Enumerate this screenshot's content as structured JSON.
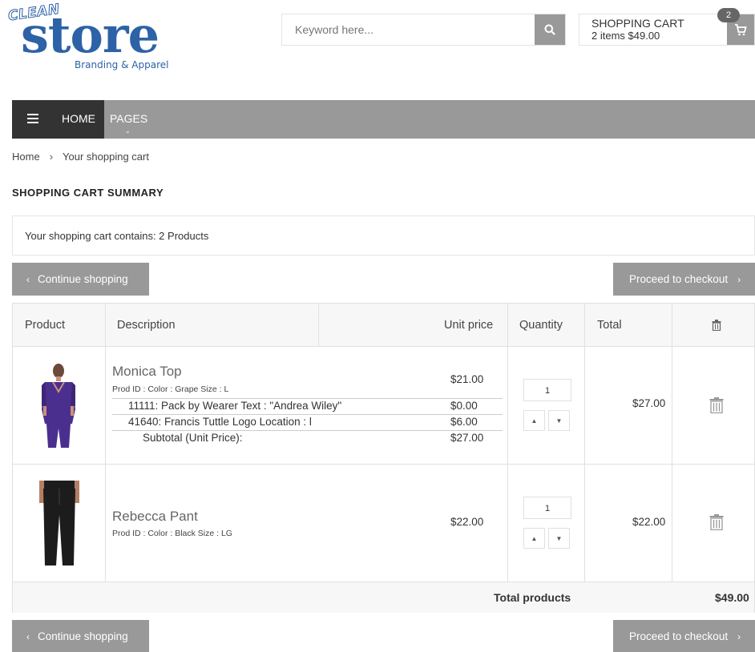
{
  "header": {
    "logo": {
      "clean": "CLEAN",
      "store": "store",
      "tagline": "Branding & Apparel"
    },
    "search": {
      "placeholder": "Keyword here..."
    },
    "cart": {
      "title": "SHOPPING CART",
      "summary": "2 items $49.00",
      "count": "2"
    }
  },
  "nav": {
    "home": "HOME",
    "pages": "PAGES"
  },
  "breadcrumb": {
    "home": "Home",
    "current": "Your shopping cart"
  },
  "page_title": "SHOPPING CART SUMMARY",
  "cart_contains": "Your shopping cart contains: 2 Products",
  "buttons": {
    "continue": "Continue shopping",
    "checkout": "Proceed to checkout"
  },
  "table": {
    "headers": {
      "product": "Product",
      "description": "Description",
      "unit_price": "Unit price",
      "quantity": "Quantity",
      "total": "Total"
    },
    "rows": [
      {
        "name": "Monica Top",
        "prod_id": "Prod ID : Color : Grape Size : L",
        "unit_price": "$21.00",
        "options": [
          {
            "label": "11111: Pack by Wearer     Text : \"Andrea Wiley\"",
            "price": "$0.00"
          },
          {
            "label": "41640: Francis Tuttle Logo     Location : l",
            "price": "$6.00"
          },
          {
            "label": "Subtotal (Unit Price):",
            "price": "$27.00"
          }
        ],
        "quantity": "1",
        "total": "$27.00",
        "image_color": "#4b2f8e"
      },
      {
        "name": "Rebecca Pant",
        "prod_id": "Prod ID : Color : Black Size : LG",
        "unit_price": "$22.00",
        "options": [],
        "quantity": "1",
        "total": "$22.00",
        "image_color": "#1c1c1c"
      }
    ],
    "footer": {
      "label": "Total products",
      "value": "$49.00"
    }
  },
  "colors": {
    "brand": "#2d62a7",
    "button_gray": "#999999",
    "nav_dark": "#333333"
  }
}
